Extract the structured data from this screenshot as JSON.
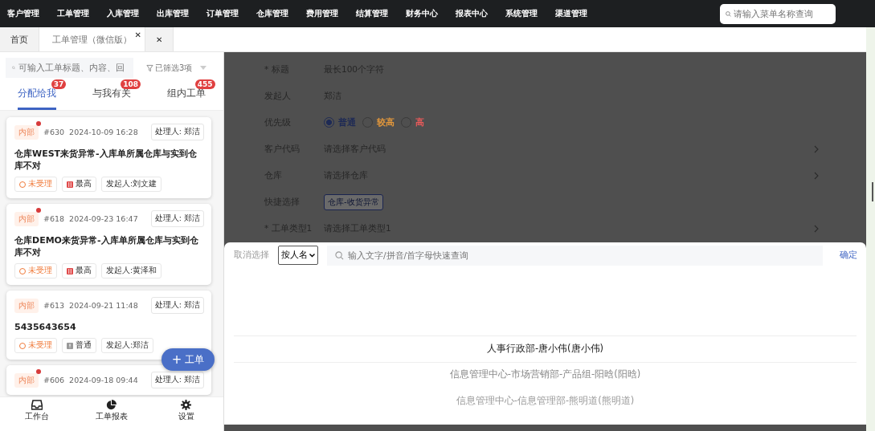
{
  "top_nav": {
    "items": [
      {
        "label": "客户管理"
      },
      {
        "label": "工单管理"
      },
      {
        "label": "入库管理"
      },
      {
        "label": "出库管理"
      },
      {
        "label": "订单管理"
      },
      {
        "label": "仓库管理"
      },
      {
        "label": "费用管理"
      },
      {
        "label": "结算管理"
      },
      {
        "label": "财务中心"
      },
      {
        "label": "报表中心"
      },
      {
        "label": "系统管理"
      },
      {
        "label": "渠道管理"
      }
    ],
    "search": {
      "placeholder": "请输入菜单名称查询"
    }
  },
  "page_tabs": [
    {
      "label": "首页",
      "selected": false
    },
    {
      "label": "工单管理（微信版）",
      "selected": true,
      "close": "✕"
    },
    {
      "selected": false,
      "close": "✕"
    }
  ],
  "sidebar": {
    "search": {
      "placeholder": "可输入工单标题、内容、回"
    },
    "filter": "已筛选3项",
    "tabs": [
      {
        "label": "分配给我",
        "badge": "37",
        "selected": true
      },
      {
        "label": "与我有关",
        "badge": "108",
        "selected": false
      },
      {
        "label": "组内工单",
        "badge": "455",
        "selected": false
      }
    ],
    "tickets": [
      {
        "tag": "内部",
        "unread": true,
        "number": "#630",
        "date": "2024-10-09 16:28",
        "handler": "处理人: 郑洁",
        "title": "仓库WEST来货异常-入库单所属仓库与实到仓库不对",
        "status": "未受理",
        "priority": {
          "label": "最高",
          "kind": "highest"
        },
        "initiator": "发起人:刘文建"
      },
      {
        "tag": "内部",
        "unread": true,
        "number": "#618",
        "date": "2024-09-23 16:47",
        "handler": "处理人: 郑洁",
        "title": "仓库DEMO来货异常-入库单所属仓库与实到仓库不对",
        "status": "未受理",
        "priority": {
          "label": "最高",
          "kind": "highest"
        },
        "initiator": "发起人:黄泽和"
      },
      {
        "tag": "内部",
        "unread": false,
        "number": "#613",
        "date": "2024-09-21 11:48",
        "handler": "处理人: 郑洁",
        "title": "5435643654",
        "status": "未受理",
        "priority": {
          "label": "普通",
          "kind": "normal"
        },
        "initiator": "发起人:郑洁"
      },
      {
        "tag": "内部",
        "unread": true,
        "number": "#606",
        "date": "2024-09-18 09:44",
        "handler": "处理人: 郑洁"
      }
    ],
    "fab": {
      "icon": "+",
      "label": "工单"
    },
    "bottom_nav": [
      {
        "label": "工作台",
        "kind": "inbox"
      },
      {
        "label": "工单报表",
        "kind": "pie"
      },
      {
        "label": "设置",
        "kind": "gear"
      }
    ]
  },
  "form": {
    "rows": [
      {
        "label": "* 标题",
        "kind": "text",
        "value": "最长100个字符"
      },
      {
        "label": "发起人",
        "kind": "text",
        "value": "郑洁"
      },
      {
        "label": "优先级",
        "kind": "radio",
        "options": [
          {
            "label": "普通",
            "selected": true,
            "color": "#1e2a55"
          },
          {
            "label": "较高",
            "selected": false,
            "color": "#e0963c"
          },
          {
            "label": "高",
            "selected": false,
            "color": "#e85a5a"
          }
        ]
      },
      {
        "label": "客户代码",
        "kind": "select",
        "value": "请选择客户代码"
      },
      {
        "label": "仓库",
        "kind": "select",
        "value": "请选择仓库"
      },
      {
        "label": "快捷选择",
        "kind": "chips",
        "chips": [
          "仓库-收货异常"
        ]
      },
      {
        "label": "* 工单类型1",
        "kind": "select",
        "value": "请选择工单类型1"
      }
    ]
  },
  "picker": {
    "cancel": "取消选择",
    "mode": "按人名",
    "search": {
      "placeholder": "输入文字/拼音/首字母快速查询"
    },
    "confirm": "确定",
    "options": [
      {
        "label": "人事行政部-唐小伟(唐小伟)",
        "selected": true
      },
      {
        "label": "信息管理中心-市场营销部-产品组-阳晗(阳晗)",
        "selected": false
      },
      {
        "label": "信息管理中心-信息管理部-熊明道(熊明道)",
        "selected": false
      }
    ]
  }
}
